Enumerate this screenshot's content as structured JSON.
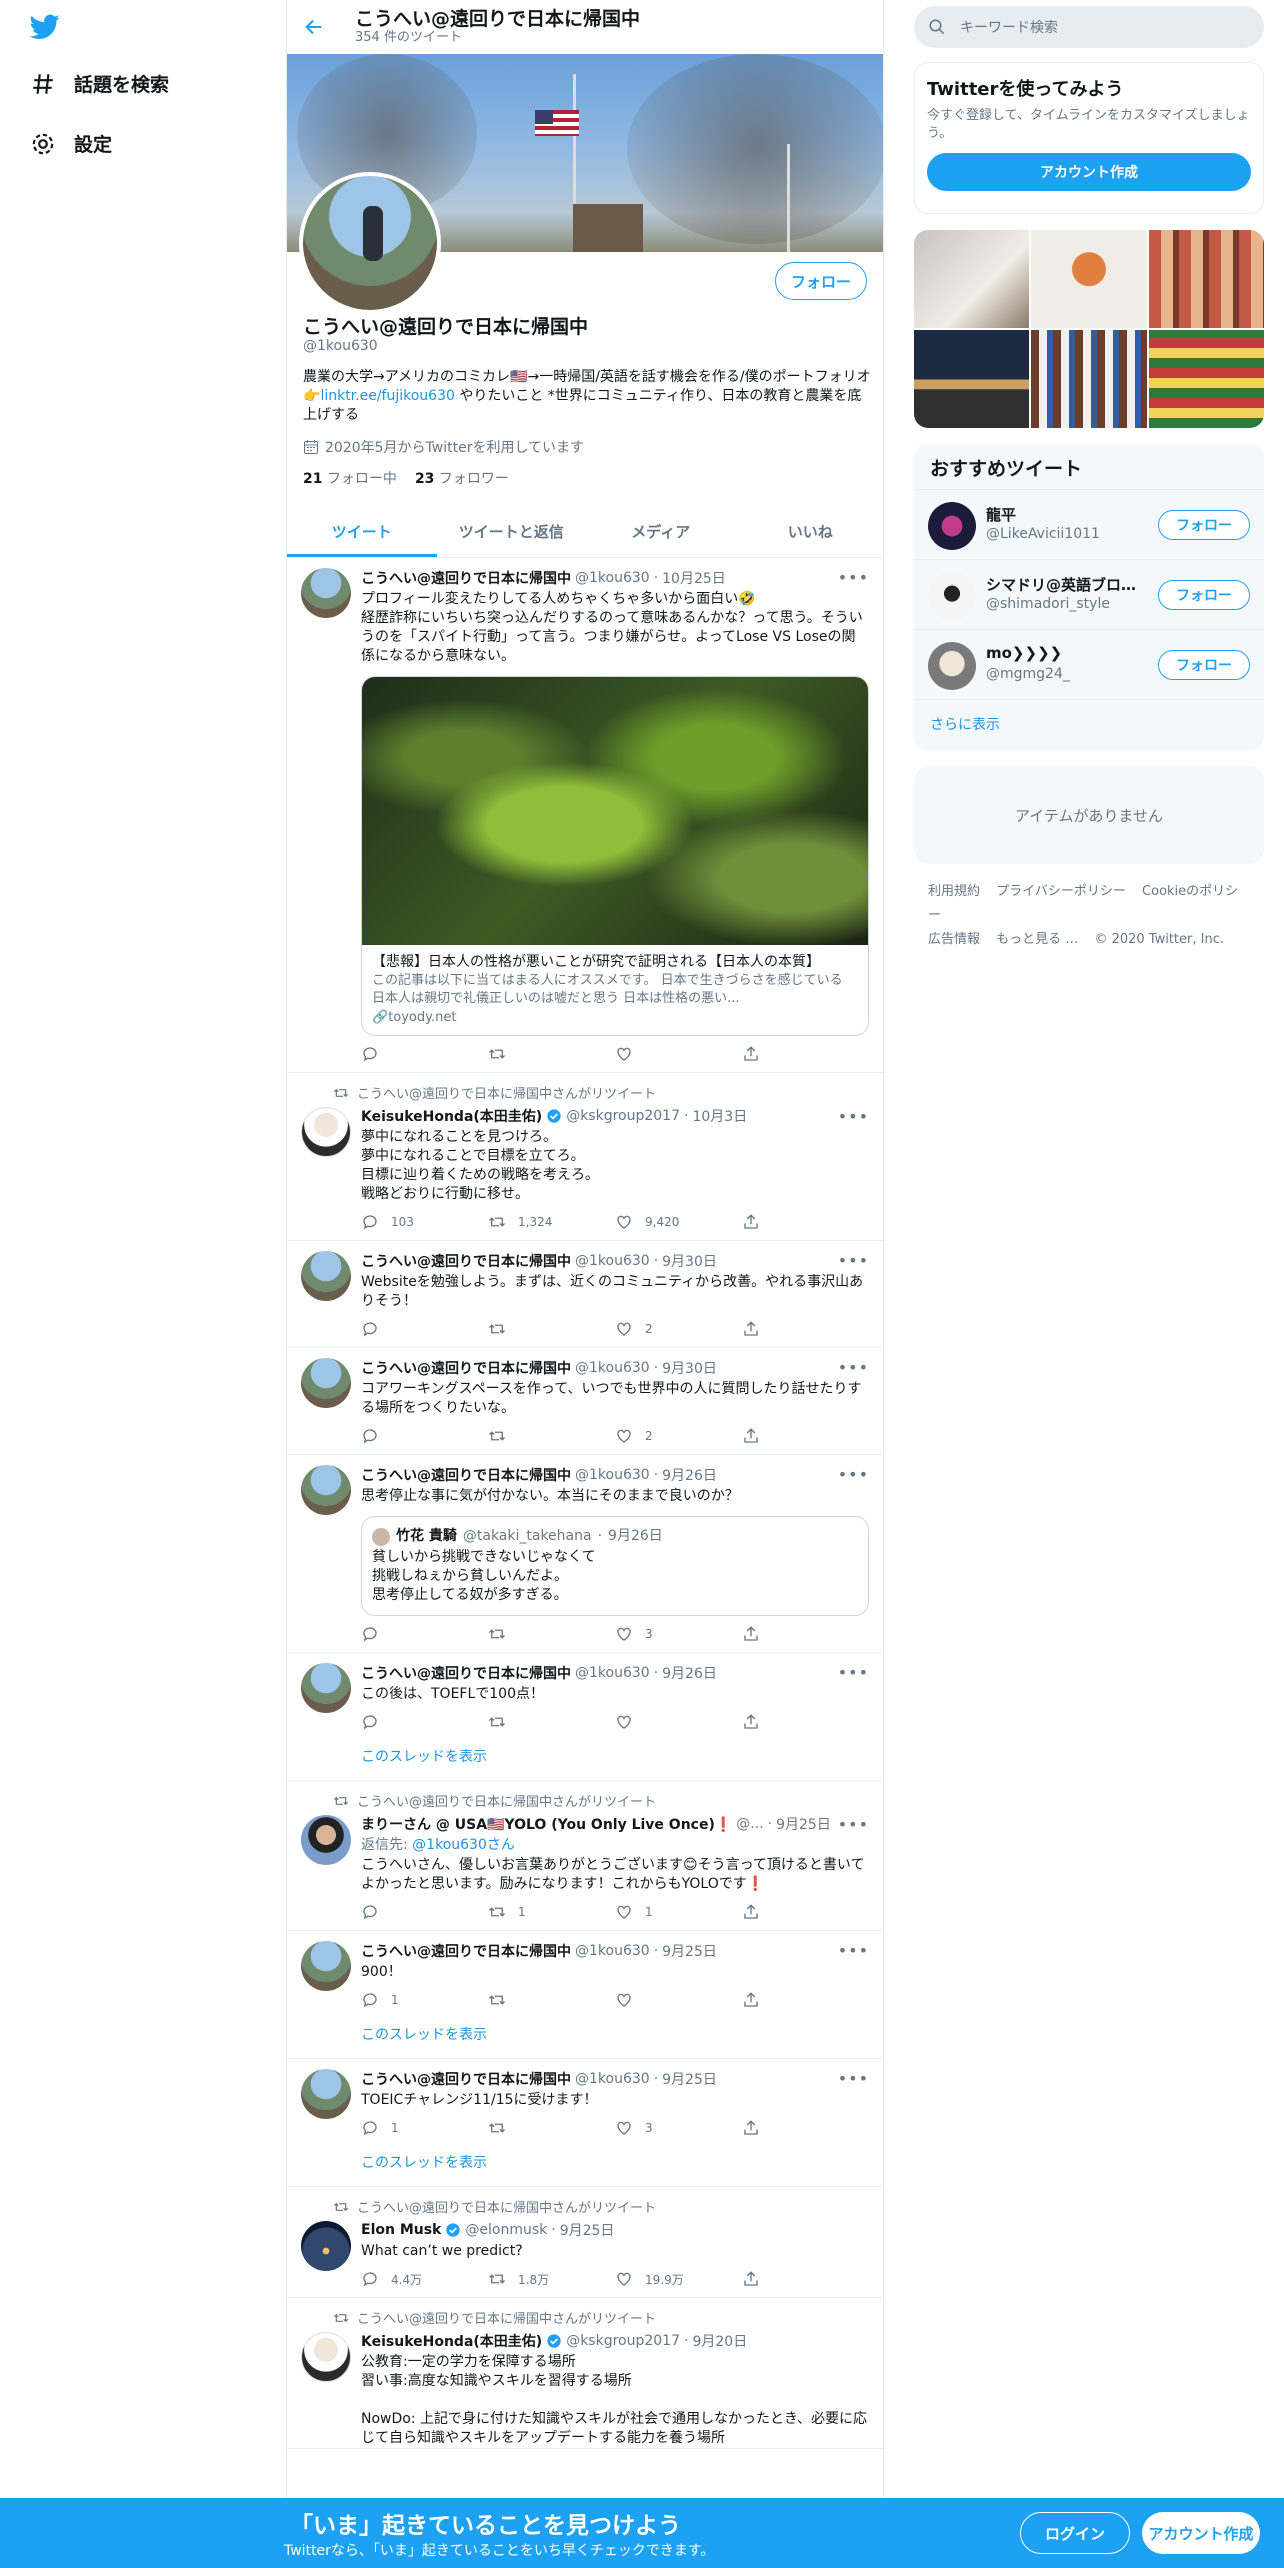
{
  "nav": {
    "explore": "話題を検索",
    "settings": "設定"
  },
  "profile": {
    "header_name": "こうへい@遠回りで日本に帰国中",
    "tweet_count": "354 件のツイート",
    "name": "こうへい@遠回りで日本に帰国中",
    "handle": "@1kou630",
    "bio_part1": "農業の大学→アメリカのコミカレ🇺🇸→一時帰国/英語を話す機会を作る/僕のポートフォリオ👉",
    "bio_link": "linktr.ee/fujikou630",
    "bio_part2": " やりたいこと *世界にコミュニティ作り、日本の教育と農業を底上げする",
    "joined": "2020年5月からTwitterを利用しています",
    "following_count": "21",
    "following_label": "フォロー中",
    "followers_count": "23",
    "followers_label": "フォロワー",
    "follow_button": "フォロー"
  },
  "tabs": [
    "ツイート",
    "ツイートと返信",
    "メディア",
    "いいね"
  ],
  "tweets": [
    {
      "name": "こうへい@遠回りで日本に帰国中",
      "handle": "@1kou630",
      "date": "10月25日",
      "text": "プロフィール変えたりしてる人めちゃくちゃ多いから面白い🤣\n経歴詐称にいちいち突っ込んだりするのって意味あるんかな？って思う。そういうのを「スパイト行動」って言う。つまり嫌がらせ。よってLose VS Loseの関係になるから意味ない。",
      "card_title": "【悲報】日本人の性格が悪いことが研究で証明される【日本人の本質】",
      "card_desc": "この記事は以下に当てはまる人にオススメです。 日本で生きづらさを感じている 日本人は親切で礼儀正しいのは嘘だと思う 日本は性格の悪い...",
      "card_domain": "toyody.net",
      "reply": "",
      "retweet": "",
      "like": ""
    },
    {
      "retweeted_by": "こうへい@遠回りで日本に帰国中さんがリツイート",
      "name": "KeisukeHonda(本田圭佑)",
      "handle": "@kskgroup2017",
      "date": "10月3日",
      "text": "夢中になれることを見つけろ。\n夢中になれることで目標を立てろ。\n目標に辿り着くための戦略を考えろ。\n戦略どおりに行動に移せ。",
      "reply": "103",
      "retweet": "1,324",
      "like": "9,420"
    },
    {
      "name": "こうへい@遠回りで日本に帰国中",
      "handle": "@1kou630",
      "date": "9月30日",
      "text": "Websiteを勉強しよう。まずは、近くのコミュニティから改善。やれる事沢山ありそう！",
      "reply": "",
      "retweet": "",
      "like": "2"
    },
    {
      "name": "こうへい@遠回りで日本に帰国中",
      "handle": "@1kou630",
      "date": "9月30日",
      "text": "コアワーキングスペースを作って、いつでも世界中の人に質問したり話せたりする場所をつくりたいな。",
      "reply": "",
      "retweet": "",
      "like": "2"
    },
    {
      "name": "こうへい@遠回りで日本に帰国中",
      "handle": "@1kou630",
      "date": "9月26日",
      "text": "思考停止な事に気が付かない。本当にそのままで良いのか？",
      "quote_name": "竹花 貴騎",
      "quote_handle": "@takaki_takehana",
      "quote_date": "9月26日",
      "quote_text": "貧しいから挑戦できないじゃなくて\n挑戦しねぇから貧しいんだよ。\n思考停止してる奴が多すぎる。",
      "reply": "",
      "retweet": "",
      "like": "3"
    },
    {
      "name": "こうへい@遠回りで日本に帰国中",
      "handle": "@1kou630",
      "date": "9月26日",
      "text": "この後は、TOEFLで100点！",
      "thread": "このスレッドを表示",
      "reply": "",
      "retweet": "",
      "like": ""
    },
    {
      "retweeted_by": "こうへい@遠回りで日本に帰国中さんがリツイート",
      "name": "まりーさん @ USA🇺🇸YOLO (You Only Live Once)❗",
      "handle": "@...",
      "date": "9月25日",
      "reply_to_label": "返信先: ",
      "reply_to_handle": "@1kou630さん",
      "text": "こうへいさん、優しいお言葉ありがとうございます😊そう言って頂けると書いてよかったと思います。励みになります！これからもYOLOです❗",
      "reply": "",
      "retweet": "1",
      "like": "1"
    },
    {
      "name": "こうへい@遠回りで日本に帰国中",
      "handle": "@1kou630",
      "date": "9月25日",
      "text": "900！",
      "thread": "このスレッドを表示",
      "reply": "1",
      "retweet": "",
      "like": ""
    },
    {
      "name": "こうへい@遠回りで日本に帰国中",
      "handle": "@1kou630",
      "date": "9月25日",
      "text": "TOEICチャレンジ11/15に受けます！",
      "thread": "このスレッドを表示",
      "reply": "1",
      "retweet": "",
      "like": "3"
    },
    {
      "retweeted_by": "こうへい@遠回りで日本に帰国中さんがリツイート",
      "name": "Elon Musk",
      "handle": "@elonmusk",
      "date": "9月25日",
      "text": "What can’t we predict?",
      "reply": "4.4万",
      "retweet": "1.8万",
      "like": "19.9万"
    },
    {
      "retweeted_by": "こうへい@遠回りで日本に帰国中さんがリツイート",
      "name": "KeisukeHonda(本田圭佑)",
      "handle": "@kskgroup2017",
      "date": "9月20日",
      "text": "公教育:一定の学力を保障する場所\n習い事:高度な知識やスキルを習得する場所\n\nNowDo: 上記で身に付けた知識やスキルが社会で通用しなかったとき、必要に応じて自ら知識やスキルをアップデートする能力を養う場所",
      "reply": "",
      "retweet": "",
      "like": ""
    }
  ],
  "sidebar": {
    "search_placeholder": "キーワード検索",
    "try_title": "Twitterを使ってみよう",
    "try_desc": "今すぐ登録して、タイムラインをカスタマイズしましょう。",
    "create_account": "アカウント作成",
    "rec_title": "おすすめツイート",
    "recs": [
      {
        "name": "龍平",
        "handle": "@LikeAvicii1011",
        "button": "フォロー"
      },
      {
        "name": "シマドリ@英語ブロガー",
        "handle": "@shimadori_style",
        "button": "フォロー"
      },
      {
        "name": "mo❯❯❯❯",
        "handle": "@mgmg24_",
        "button": "フォロー"
      }
    ],
    "show_more": "さらに表示",
    "no_items": "アイテムがありません",
    "footer": [
      "利用規約",
      "プライバシーポリシー",
      "Cookieのポリシー",
      "広告情報",
      "もっと見る …",
      "© 2020 Twitter, Inc."
    ]
  },
  "bottom": {
    "headline": "「いま」起きていることを見つけよう",
    "sub": "Twitterなら、「いま」起きていることをいち早くチェックできます。",
    "login": "ログイン",
    "signup": "アカウント作成"
  },
  "colors": {
    "accent": "#1da1f2",
    "link": "#1b95e0",
    "text_secondary": "#657786"
  }
}
